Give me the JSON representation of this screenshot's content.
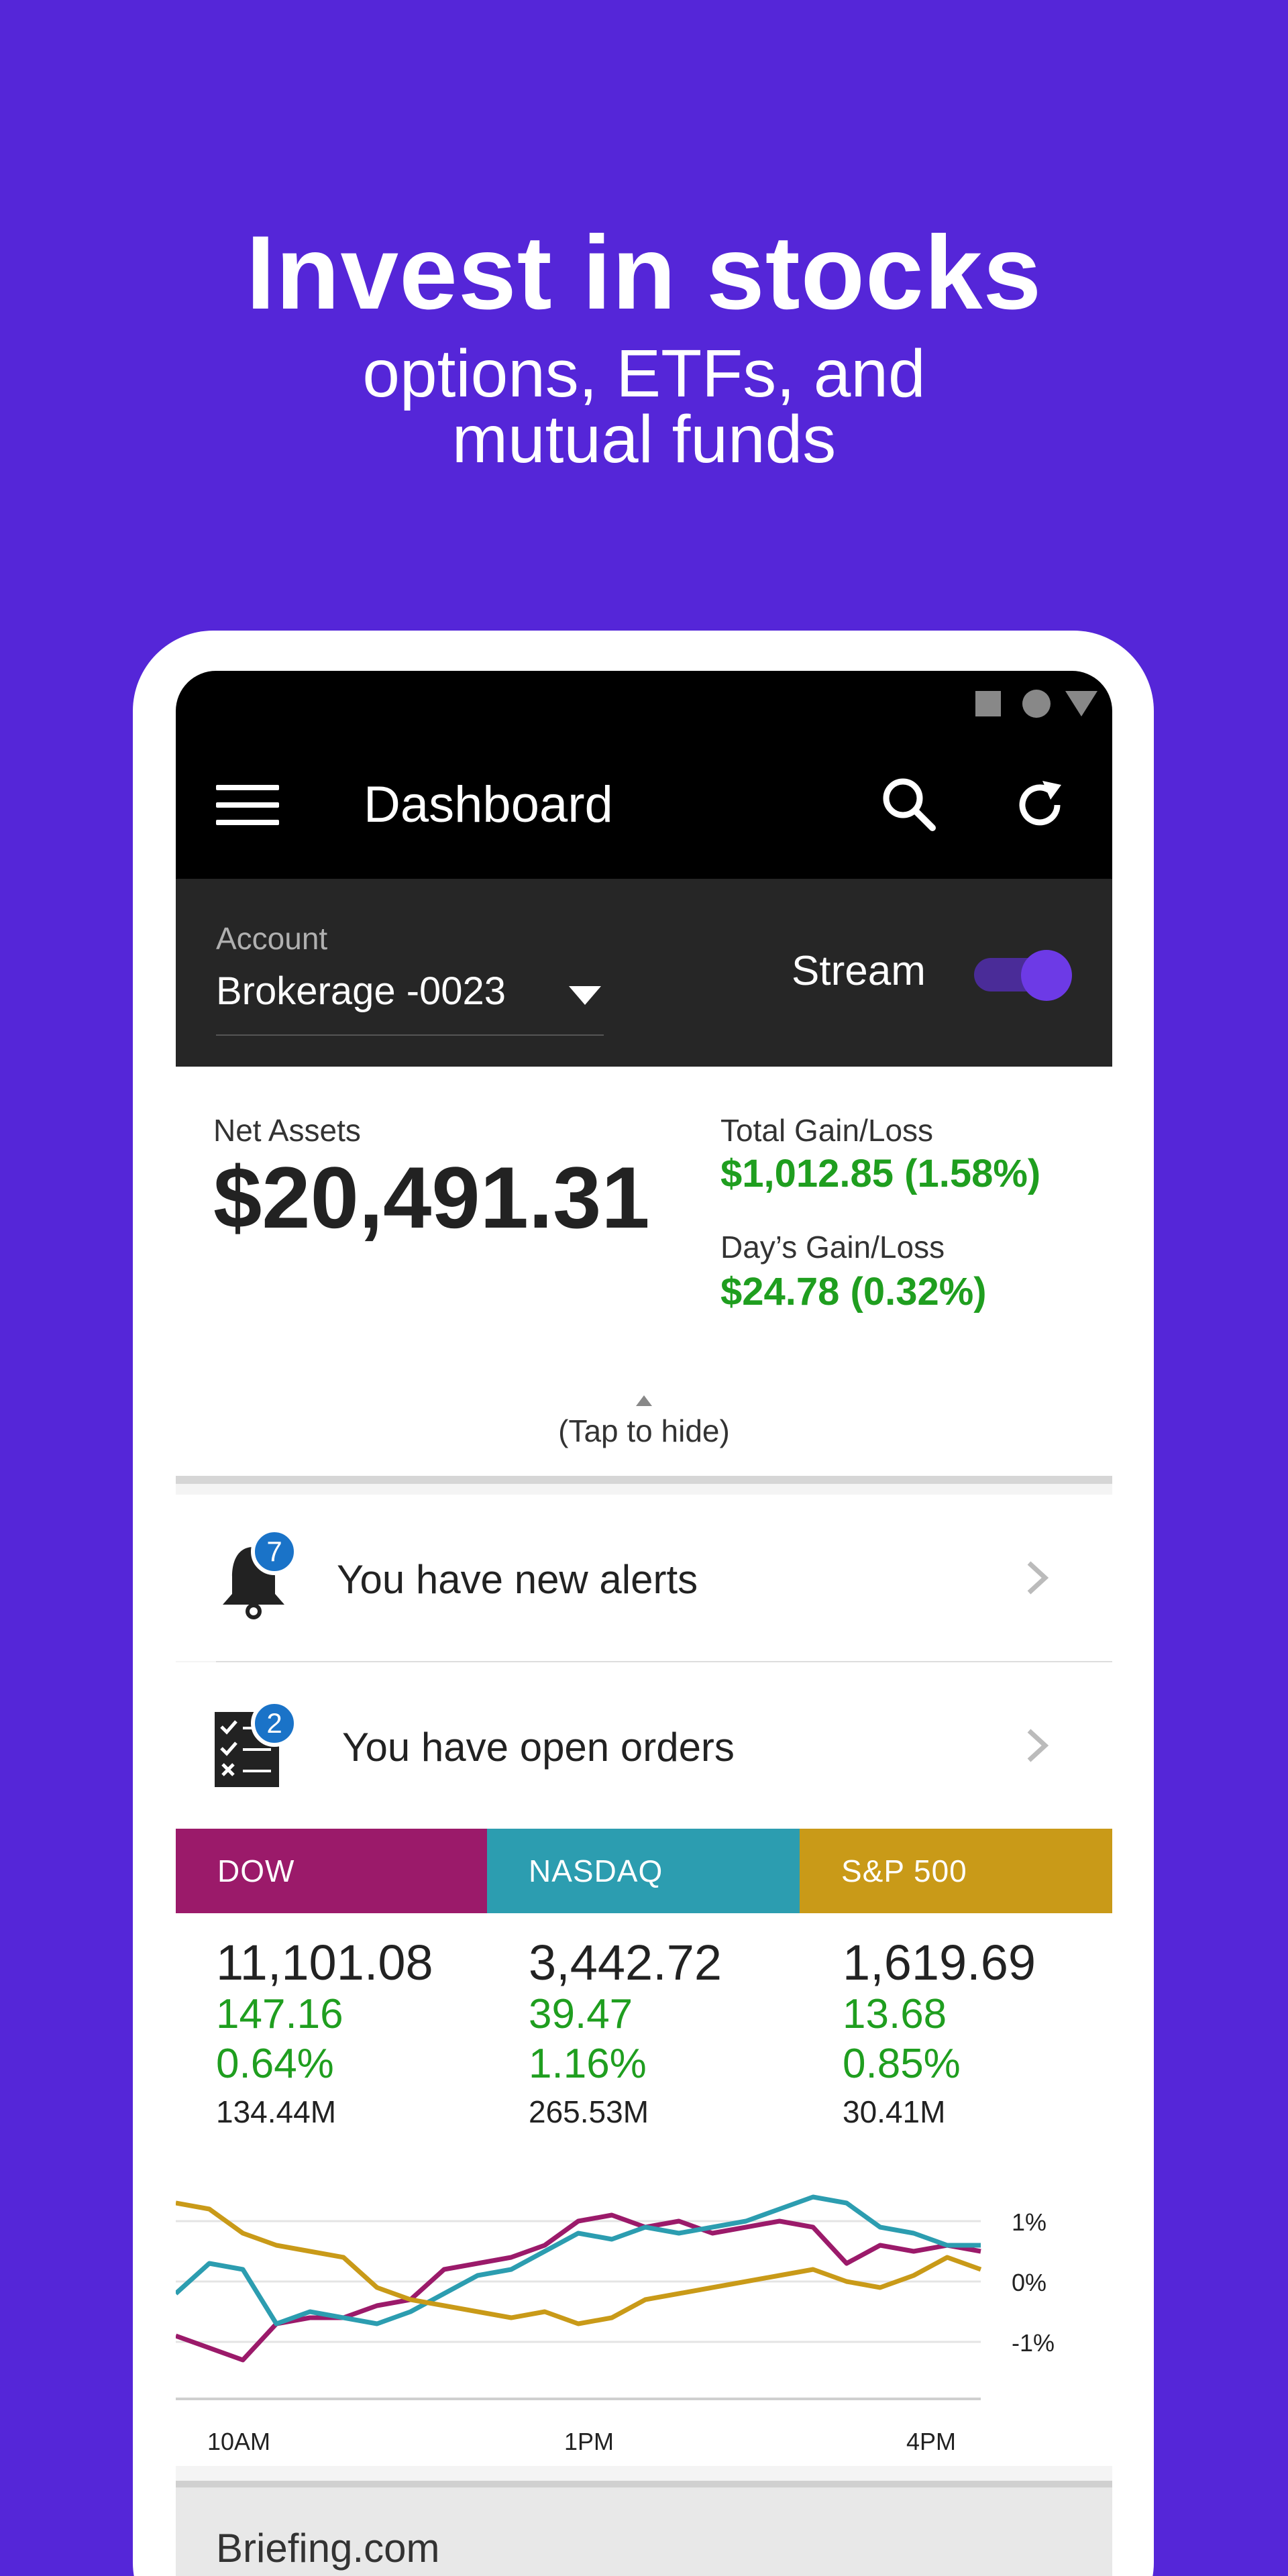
{
  "promo": {
    "title": "Invest in stocks",
    "subtitle_line1": "options, ETFs, and",
    "subtitle_line2": "mutual funds"
  },
  "appbar": {
    "title": "Dashboard",
    "icons": [
      "menu-icon",
      "search-icon",
      "refresh-icon"
    ]
  },
  "account": {
    "label": "Account",
    "value": "Brokerage -0023",
    "stream_label": "Stream",
    "stream_on": true
  },
  "summary": {
    "net_assets_label": "Net Assets",
    "net_assets_value": "$20,491.31",
    "total_gain_label": "Total Gain/Loss",
    "total_gain_value": "$1,012.85 (1.58%)",
    "day_gain_label": "Day’s Gain/Loss",
    "day_gain_value": "$24.78 (0.32%)",
    "tap_hide": "(Tap to hide)"
  },
  "alerts": {
    "text": "You have new alerts",
    "badge": "7"
  },
  "orders": {
    "text": "You have open orders",
    "badge": "2"
  },
  "indices": [
    {
      "name": "DOW",
      "value": "11,101.08",
      "change": "147.16",
      "percent": "0.64%",
      "volume": "134.44M",
      "color": "#9b1a6a"
    },
    {
      "name": "NASDAQ",
      "value": "3,442.72",
      "change": "39.47",
      "percent": "1.16%",
      "volume": "265.53M",
      "color": "#2c9db0"
    },
    {
      "name": "S&P 500",
      "value": "1,619.69",
      "change": "13.68",
      "percent": "0.85%",
      "volume": "30.41M",
      "color": "#c99a18"
    }
  ],
  "chart_data": {
    "type": "line",
    "x": [
      "10AM",
      "1PM",
      "4PM"
    ],
    "y_ticks": [
      "1%",
      "0%",
      "-1%"
    ],
    "ylim": [
      -1.5,
      1.5
    ],
    "series": [
      {
        "name": "DOW",
        "color": "#9b1a6a",
        "values": [
          -0.9,
          -1.1,
          -1.3,
          -0.7,
          -0.6,
          -0.6,
          -0.4,
          -0.3,
          0.2,
          0.3,
          0.4,
          0.6,
          1.0,
          1.1,
          0.9,
          1.0,
          0.8,
          0.9,
          1.0,
          0.9,
          0.3,
          0.6,
          0.5,
          0.6,
          0.5
        ]
      },
      {
        "name": "NASDAQ",
        "color": "#2c9db0",
        "values": [
          -0.2,
          0.3,
          0.2,
          -0.7,
          -0.5,
          -0.6,
          -0.7,
          -0.5,
          -0.2,
          0.1,
          0.2,
          0.5,
          0.8,
          0.7,
          0.9,
          0.8,
          0.9,
          1.0,
          1.2,
          1.4,
          1.3,
          0.9,
          0.8,
          0.6,
          0.6
        ]
      },
      {
        "name": "S&P 500",
        "color": "#c99a18",
        "values": [
          1.3,
          1.2,
          0.8,
          0.6,
          0.5,
          0.4,
          -0.1,
          -0.3,
          -0.4,
          -0.5,
          -0.6,
          -0.5,
          -0.7,
          -0.6,
          -0.3,
          -0.2,
          -0.1,
          0.0,
          0.1,
          0.2,
          0.0,
          -0.1,
          0.1,
          0.4,
          0.2
        ]
      }
    ]
  },
  "briefing": {
    "text": "Briefing.com"
  }
}
